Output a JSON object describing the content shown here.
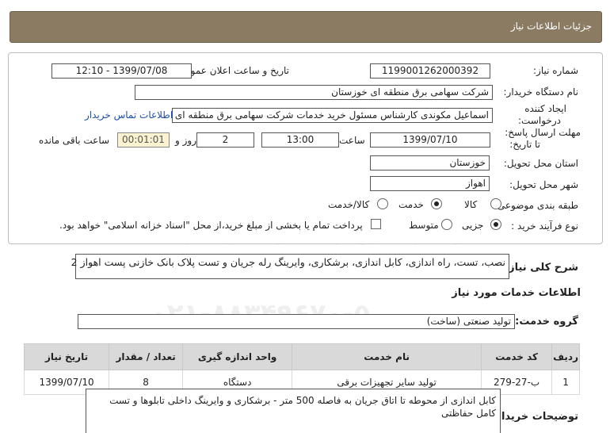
{
  "header": {
    "title": "جزئیات اطلاعات نیاز"
  },
  "form": {
    "need_number_label": "شماره نیاز:",
    "need_number": "1199001262000392",
    "announce_label": "تاریخ و ساعت اعلان عمومی:",
    "announce_value": "1399/07/08 - 12:10",
    "buyer_label": "نام دستگاه خریدار:",
    "buyer_value": "شرکت سهامی برق منطقه ای خوزستان",
    "creator_label_1": "ایجاد کننده",
    "creator_label_2": "درخواست:",
    "creator_value": "اسماعیل مکوندی کارشناس مسئول خرید خدمات شرکت سهامی برق منطقه ای خوزستان",
    "contact_link": "اطلاعات تماس خریدار",
    "deadline_label_1": "مهلت ارسال پاسخ:",
    "deadline_label_2": "تا تاریخ:",
    "deadline_date": "1399/07/10",
    "time_label": "ساعت",
    "deadline_time": "13:00",
    "days_value": "2",
    "days_label": "روز و",
    "remaining_time": "00:01:01",
    "remaining_label": "ساعت باقی مانده",
    "province_label": "استان محل تحویل:",
    "province_value": "خوزستان",
    "city_label": "شهر محل تحویل:",
    "city_value": "اهواز",
    "category_label": "طبقه بندی موضوعی:",
    "category_options": [
      "کالا",
      "خدمت",
      "کالا/خدمت"
    ],
    "category_selected": "خدمت",
    "process_label": "نوع فرآیند خرید :",
    "process_options": [
      "جزیی",
      "متوسط"
    ],
    "process_selected": "جزیی",
    "payment_note": "پرداخت تمام یا بخشی از مبلغ خرید،از محل \"اسناد خزانه اسلامی\" خواهد بود."
  },
  "summary": {
    "label": "شرح کلی نیاز:",
    "value": "نصب، تست، راه اندازی، کابل اندازی، برشکاری، وایرینگ رله جریان و تست پلاک بانک خازنی پست اهواز 2"
  },
  "services": {
    "section_title": "اطلاعات خدمات مورد نیاز",
    "group_label": "گروه خدمت:",
    "group_value": "تولید صنعتی (ساخت)",
    "columns": [
      "ردیف",
      "کد خدمت",
      "نام خدمت",
      "واحد اندازه گیری",
      "تعداد / مقدار",
      "تاریخ نیاز"
    ],
    "rows": [
      [
        "1",
        "ب-27-279",
        "تولید سایر تجهیزات برقی",
        "دستگاه",
        "8",
        "1399/07/10"
      ]
    ]
  },
  "notes": {
    "label": "توضیحات خریدار:",
    "value": "کابل اندازی از محوطه تا اتاق جریان به فاصله 500 متر - برشکاری و وایرینگ داخلی تابلوها و تست کامل حفاظتی"
  },
  "watermark": {
    "line1": "ParsNamadData",
    "line2": "۰۲۱-۸۸۳۴۹۶۷۰-۵"
  },
  "colors": {
    "header_bg": "#8c7b63",
    "timer_bg": "#fbf2d0",
    "link": "#1f4fa8",
    "table_head": "#d9d9d9"
  }
}
